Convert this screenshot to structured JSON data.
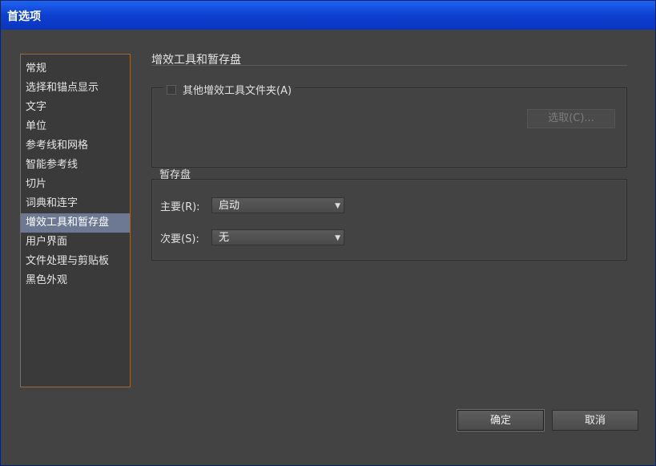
{
  "window": {
    "title": "首选项"
  },
  "sidebar": {
    "items": [
      {
        "label": "常规"
      },
      {
        "label": "选择和锚点显示"
      },
      {
        "label": "文字"
      },
      {
        "label": "单位"
      },
      {
        "label": "参考线和网格"
      },
      {
        "label": "智能参考线"
      },
      {
        "label": "切片"
      },
      {
        "label": "词典和连字"
      },
      {
        "label": "增效工具和暂存盘"
      },
      {
        "label": "用户界面"
      },
      {
        "label": "文件处理与剪贴板"
      },
      {
        "label": "黑色外观"
      }
    ],
    "selected_index": 8
  },
  "content": {
    "section_title": "增效工具和暂存盘",
    "plugins": {
      "checkbox_label": "其他增效工具文件夹(A)",
      "checked": false,
      "choose_button": "选取(C)..."
    },
    "scratch": {
      "title": "暂存盘",
      "primary_label": "主要(R):",
      "primary_value": "启动",
      "secondary_label": "次要(S):",
      "secondary_value": "无"
    }
  },
  "buttons": {
    "ok": "确定",
    "cancel": "取消"
  },
  "colors": {
    "titlebar": "#0d3fd0",
    "panel_bg": "#434343",
    "selection": "#6d7992",
    "sidebar_border": "#9a6a35"
  }
}
